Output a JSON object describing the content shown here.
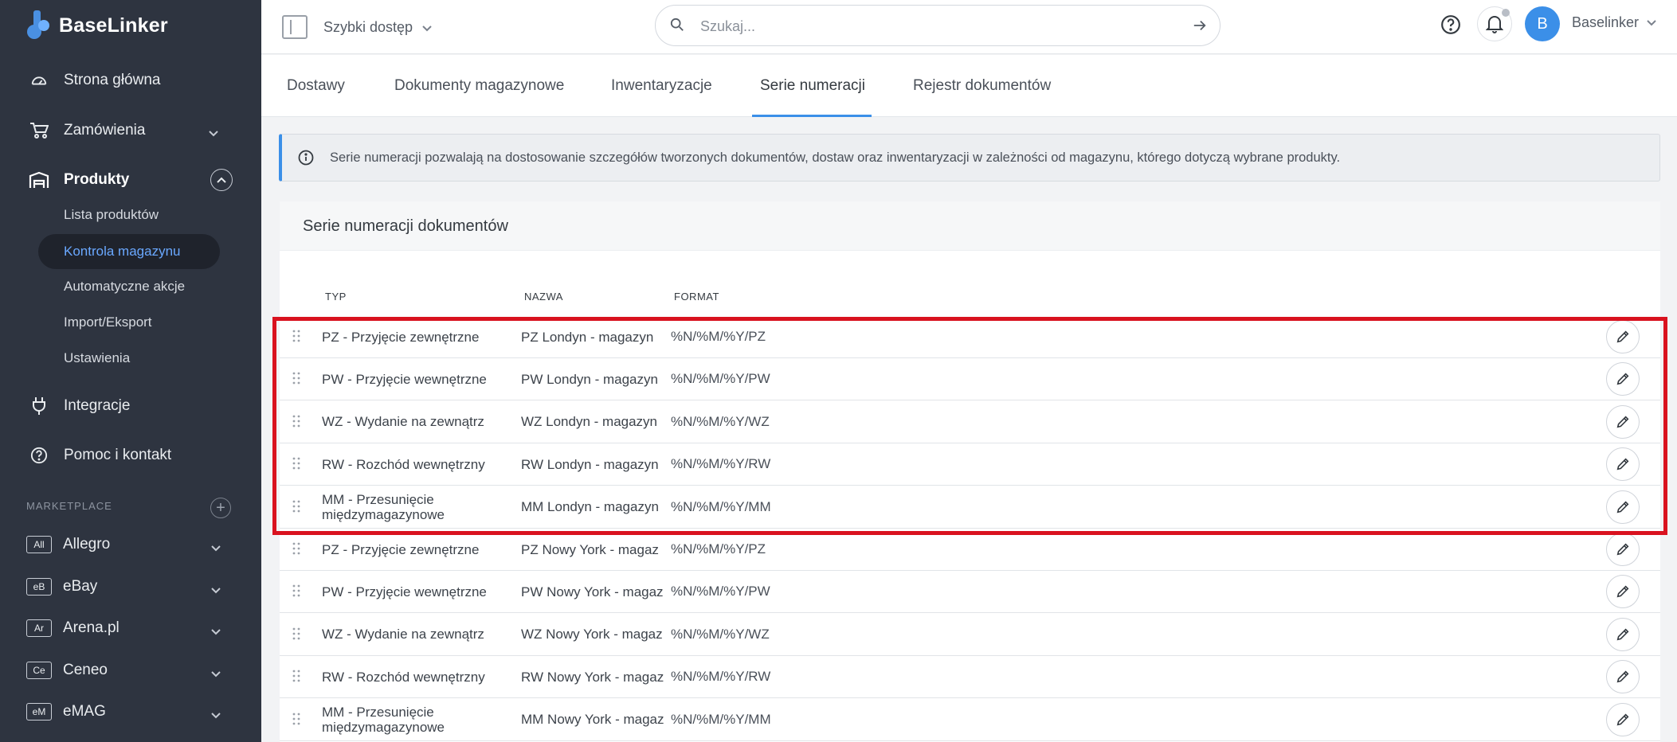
{
  "brand": {
    "name": "BaseLinker"
  },
  "sidebar": {
    "items": [
      {
        "label": "Strona główna",
        "icon": "dashboard-icon"
      },
      {
        "label": "Zamówienia",
        "icon": "cart-icon"
      },
      {
        "label": "Produkty",
        "icon": "warehouse-icon"
      },
      {
        "label": "Integracje",
        "icon": "plug-icon"
      },
      {
        "label": "Pomoc i kontakt",
        "icon": "help-icon"
      }
    ],
    "sub_items": [
      "Lista produktów",
      "Kontrola magazynu",
      "Automatyczne akcje",
      "Import/Eksport",
      "Ustawienia"
    ],
    "marketplace_label": "MARKETPLACE",
    "marketplaces": [
      {
        "badge": "All",
        "label": "Allegro"
      },
      {
        "badge": "eB",
        "label": "eBay"
      },
      {
        "badge": "Ar",
        "label": "Arena.pl"
      },
      {
        "badge": "Ce",
        "label": "Ceneo"
      },
      {
        "badge": "eM",
        "label": "eMAG"
      }
    ]
  },
  "header": {
    "quick_access": "Szybki dostęp",
    "search_placeholder": "Szukaj...",
    "avatar_initial": "B",
    "user_name": "Baselinker"
  },
  "tabs": [
    {
      "label": "Dostawy"
    },
    {
      "label": "Dokumenty magazynowe"
    },
    {
      "label": "Inwentaryzacje"
    },
    {
      "label": "Serie numeracji"
    },
    {
      "label": "Rejestr dokumentów"
    }
  ],
  "info_text": "Serie numeracji pozwalają na dostosowanie szczegółów tworzonych dokumentów, dostaw oraz inwentaryzacji w zależności od magazynu, którego dotyczą wybrane produkty.",
  "card": {
    "title": "Serie numeracji dokumentów",
    "columns": {
      "type": "TYP",
      "name": "NAZWA",
      "format": "FORMAT"
    },
    "rows": [
      {
        "type": "PZ - Przyjęcie zewnętrzne",
        "name": "PZ Londyn - magazyn",
        "format": "%N/%M/%Y/PZ"
      },
      {
        "type": "PW - Przyjęcie wewnętrzne",
        "name": "PW Londyn - magazyn",
        "format": "%N/%M/%Y/PW"
      },
      {
        "type": "WZ - Wydanie na zewnątrz",
        "name": "WZ Londyn - magazyn",
        "format": "%N/%M/%Y/WZ"
      },
      {
        "type": "RW - Rozchód wewnętrzny",
        "name": "RW Londyn - magazyn",
        "format": "%N/%M/%Y/RW"
      },
      {
        "type": "MM - Przesunięcie międzymagazynowe",
        "name": "MM Londyn - magazyn",
        "format": "%N/%M/%Y/MM"
      },
      {
        "type": "PZ - Przyjęcie zewnętrzne",
        "name": "PZ Nowy York - magaz",
        "format": "%N/%M/%Y/PZ"
      },
      {
        "type": "PW - Przyjęcie wewnętrzne",
        "name": "PW Nowy York - magaz",
        "format": "%N/%M/%Y/PW"
      },
      {
        "type": "WZ - Wydanie na zewnątrz",
        "name": "WZ Nowy York - magaz",
        "format": "%N/%M/%Y/WZ"
      },
      {
        "type": "RW - Rozchód wewnętrzny",
        "name": "RW Nowy York - magaz",
        "format": "%N/%M/%Y/RW"
      },
      {
        "type": "MM - Przesunięcie międzymagazynowe",
        "name": "MM Nowy York - magaz",
        "format": "%N/%M/%Y/MM"
      }
    ]
  },
  "colors": {
    "sidebar_bg": "#2e3440",
    "accent": "#3b8fe8",
    "highlight": "#d9121f"
  }
}
